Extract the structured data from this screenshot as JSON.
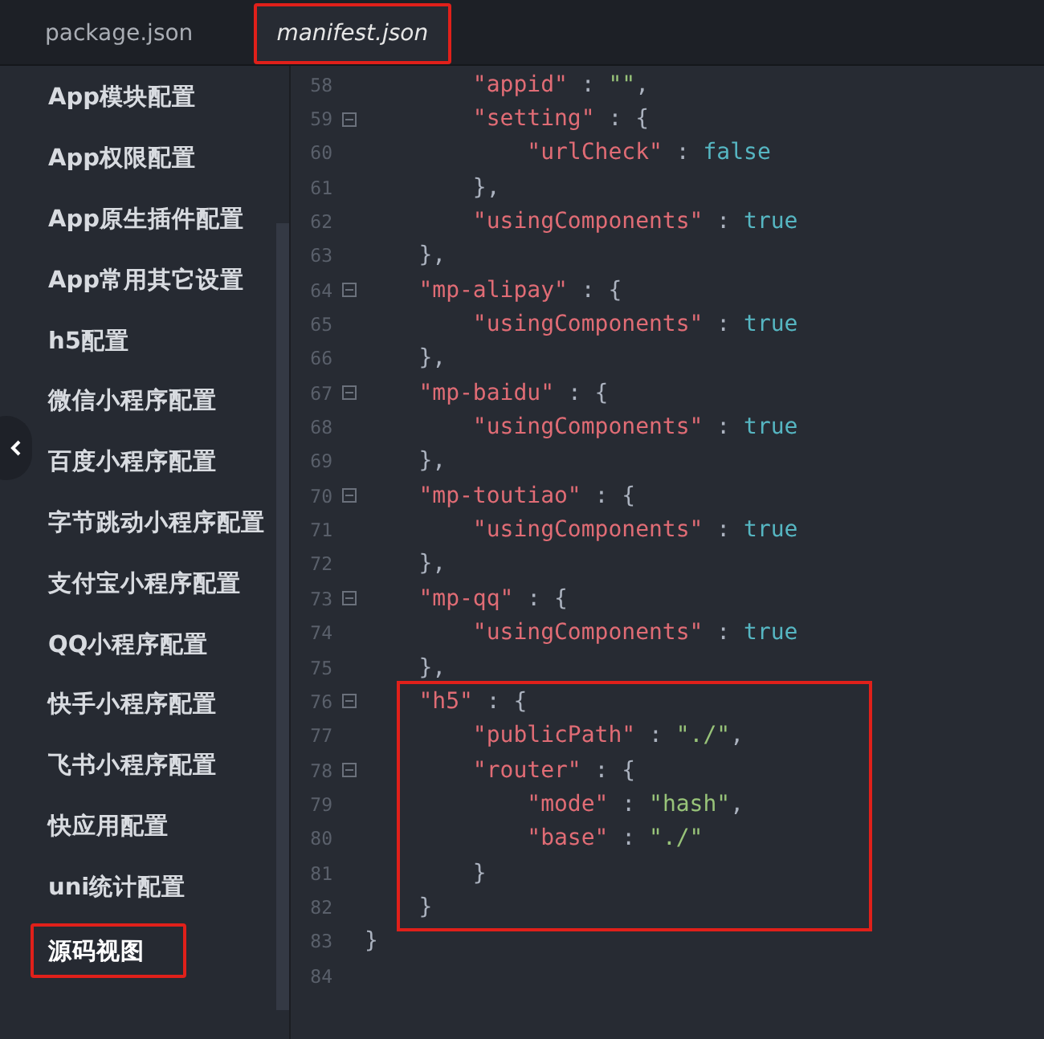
{
  "tabs": [
    {
      "label": "package.json",
      "selected": false,
      "highlighted": false
    },
    {
      "label": "manifest.json",
      "selected": true,
      "highlighted": true
    }
  ],
  "sidebar": {
    "items": [
      {
        "label": "App模块配置",
        "highlighted": false
      },
      {
        "label": "App权限配置",
        "highlighted": false
      },
      {
        "label": "App原生插件配置",
        "highlighted": false
      },
      {
        "label": "App常用其它设置",
        "highlighted": false
      },
      {
        "label": "h5配置",
        "highlighted": false
      },
      {
        "label": "微信小程序配置",
        "highlighted": false
      },
      {
        "label": "百度小程序配置",
        "highlighted": false
      },
      {
        "label": "字节跳动小程序配置",
        "highlighted": false
      },
      {
        "label": "支付宝小程序配置",
        "highlighted": false
      },
      {
        "label": "QQ小程序配置",
        "highlighted": false
      },
      {
        "label": "快手小程序配置",
        "highlighted": false
      },
      {
        "label": "飞书小程序配置",
        "highlighted": false
      },
      {
        "label": "快应用配置",
        "highlighted": false
      },
      {
        "label": "uni统计配置",
        "highlighted": false
      },
      {
        "label": "源码视图",
        "highlighted": true
      }
    ]
  },
  "editor": {
    "lines": [
      {
        "number": "58",
        "fold": false,
        "highlighted": false,
        "tokens": [
          {
            "kind": "key",
            "text": "        \"appid\""
          },
          {
            "kind": "punct",
            "text": " : "
          },
          {
            "kind": "string",
            "text": "\"\""
          },
          {
            "kind": "punct",
            "text": ","
          }
        ]
      },
      {
        "number": "59",
        "fold": true,
        "highlighted": false,
        "tokens": [
          {
            "kind": "key",
            "text": "        \"setting\""
          },
          {
            "kind": "punct",
            "text": " : {"
          }
        ]
      },
      {
        "number": "60",
        "fold": false,
        "highlighted": false,
        "tokens": [
          {
            "kind": "key",
            "text": "            \"urlCheck\""
          },
          {
            "kind": "punct",
            "text": " : "
          },
          {
            "kind": "literal",
            "text": "false"
          }
        ]
      },
      {
        "number": "61",
        "fold": false,
        "highlighted": false,
        "tokens": [
          {
            "kind": "punct",
            "text": "        },"
          }
        ]
      },
      {
        "number": "62",
        "fold": false,
        "highlighted": false,
        "tokens": [
          {
            "kind": "key",
            "text": "        \"usingComponents\""
          },
          {
            "kind": "punct",
            "text": " : "
          },
          {
            "kind": "literal",
            "text": "true"
          }
        ]
      },
      {
        "number": "63",
        "fold": false,
        "highlighted": false,
        "tokens": [
          {
            "kind": "punct",
            "text": "    },"
          }
        ]
      },
      {
        "number": "64",
        "fold": true,
        "highlighted": false,
        "tokens": [
          {
            "kind": "key",
            "text": "    \"mp-alipay\""
          },
          {
            "kind": "punct",
            "text": " : {"
          }
        ]
      },
      {
        "number": "65",
        "fold": false,
        "highlighted": false,
        "tokens": [
          {
            "kind": "key",
            "text": "        \"usingComponents\""
          },
          {
            "kind": "punct",
            "text": " : "
          },
          {
            "kind": "literal",
            "text": "true"
          }
        ]
      },
      {
        "number": "66",
        "fold": false,
        "highlighted": false,
        "tokens": [
          {
            "kind": "punct",
            "text": "    },"
          }
        ]
      },
      {
        "number": "67",
        "fold": true,
        "highlighted": false,
        "tokens": [
          {
            "kind": "key",
            "text": "    \"mp-baidu\""
          },
          {
            "kind": "punct",
            "text": " : {"
          }
        ]
      },
      {
        "number": "68",
        "fold": false,
        "highlighted": false,
        "tokens": [
          {
            "kind": "key",
            "text": "        \"usingComponents\""
          },
          {
            "kind": "punct",
            "text": " : "
          },
          {
            "kind": "literal",
            "text": "true"
          }
        ]
      },
      {
        "number": "69",
        "fold": false,
        "highlighted": false,
        "tokens": [
          {
            "kind": "punct",
            "text": "    },"
          }
        ]
      },
      {
        "number": "70",
        "fold": true,
        "highlighted": false,
        "tokens": [
          {
            "kind": "key",
            "text": "    \"mp-toutiao\""
          },
          {
            "kind": "punct",
            "text": " : {"
          }
        ]
      },
      {
        "number": "71",
        "fold": false,
        "highlighted": false,
        "tokens": [
          {
            "kind": "key",
            "text": "        \"usingComponents\""
          },
          {
            "kind": "punct",
            "text": " : "
          },
          {
            "kind": "literal",
            "text": "true"
          }
        ]
      },
      {
        "number": "72",
        "fold": false,
        "highlighted": false,
        "tokens": [
          {
            "kind": "punct",
            "text": "    },"
          }
        ]
      },
      {
        "number": "73",
        "fold": true,
        "highlighted": false,
        "tokens": [
          {
            "kind": "key",
            "text": "    \"mp-qq\""
          },
          {
            "kind": "punct",
            "text": " : {"
          }
        ]
      },
      {
        "number": "74",
        "fold": false,
        "highlighted": false,
        "tokens": [
          {
            "kind": "key",
            "text": "        \"usingComponents\""
          },
          {
            "kind": "punct",
            "text": " : "
          },
          {
            "kind": "literal",
            "text": "true"
          }
        ]
      },
      {
        "number": "75",
        "fold": false,
        "highlighted": false,
        "tokens": [
          {
            "kind": "punct",
            "text": "    },"
          }
        ]
      },
      {
        "number": "76",
        "fold": true,
        "highlighted": true,
        "tokens": [
          {
            "kind": "key",
            "text": "    \"h5\""
          },
          {
            "kind": "punct",
            "text": " : {"
          }
        ]
      },
      {
        "number": "77",
        "fold": false,
        "highlighted": true,
        "tokens": [
          {
            "kind": "key",
            "text": "        \"publicPath\""
          },
          {
            "kind": "punct",
            "text": " : "
          },
          {
            "kind": "string",
            "text": "\"./\""
          },
          {
            "kind": "punct",
            "text": ","
          }
        ]
      },
      {
        "number": "78",
        "fold": true,
        "highlighted": true,
        "tokens": [
          {
            "kind": "key",
            "text": "        \"router\""
          },
          {
            "kind": "punct",
            "text": " : {"
          }
        ]
      },
      {
        "number": "79",
        "fold": false,
        "highlighted": true,
        "tokens": [
          {
            "kind": "key",
            "text": "            \"mode\""
          },
          {
            "kind": "punct",
            "text": " : "
          },
          {
            "kind": "string",
            "text": "\"hash\""
          },
          {
            "kind": "punct",
            "text": ","
          }
        ]
      },
      {
        "number": "80",
        "fold": false,
        "highlighted": true,
        "tokens": [
          {
            "kind": "key",
            "text": "            \"base\""
          },
          {
            "kind": "punct",
            "text": " : "
          },
          {
            "kind": "string",
            "text": "\"./\""
          }
        ]
      },
      {
        "number": "81",
        "fold": false,
        "highlighted": true,
        "tokens": [
          {
            "kind": "punct",
            "text": "        }"
          }
        ]
      },
      {
        "number": "82",
        "fold": false,
        "highlighted": true,
        "tokens": [
          {
            "kind": "punct",
            "text": "    }"
          }
        ]
      },
      {
        "number": "83",
        "fold": false,
        "highlighted": false,
        "tokens": [
          {
            "kind": "punct",
            "text": "}"
          }
        ]
      },
      {
        "number": "84",
        "fold": false,
        "highlighted": false
      }
    ]
  }
}
